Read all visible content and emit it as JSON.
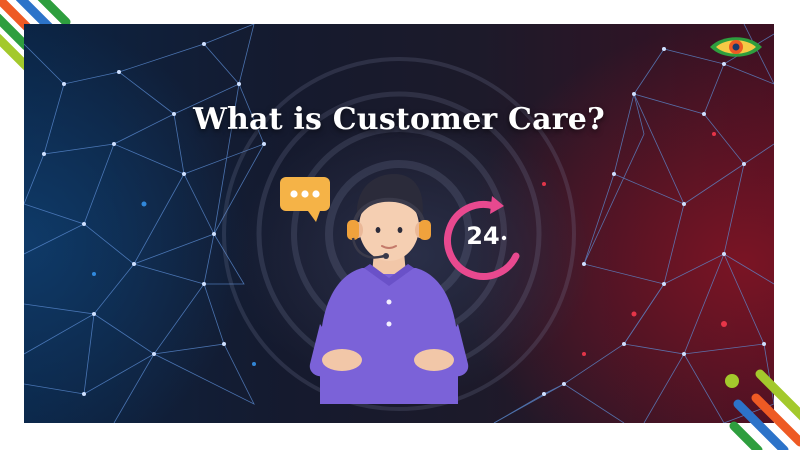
{
  "banner": {
    "title": "What is Customer Care?",
    "badge_24": "24",
    "chat_dots": "•••"
  },
  "icons": {
    "chat": "chat-bubble-icon",
    "clock24": "24-hour-clock-icon",
    "logo": "eye-logo-icon",
    "agent": "support-agent-illustration"
  },
  "colors": {
    "title": "#ffffff",
    "shirt": "#7b62d8",
    "chat_bubble": "#f5b347",
    "clock_pink": "#e8498f",
    "deco_blue": "#2c73c9",
    "deco_orange": "#ee5a24",
    "deco_green": "#2e9e3e",
    "deco_lime": "#a3c92c"
  }
}
